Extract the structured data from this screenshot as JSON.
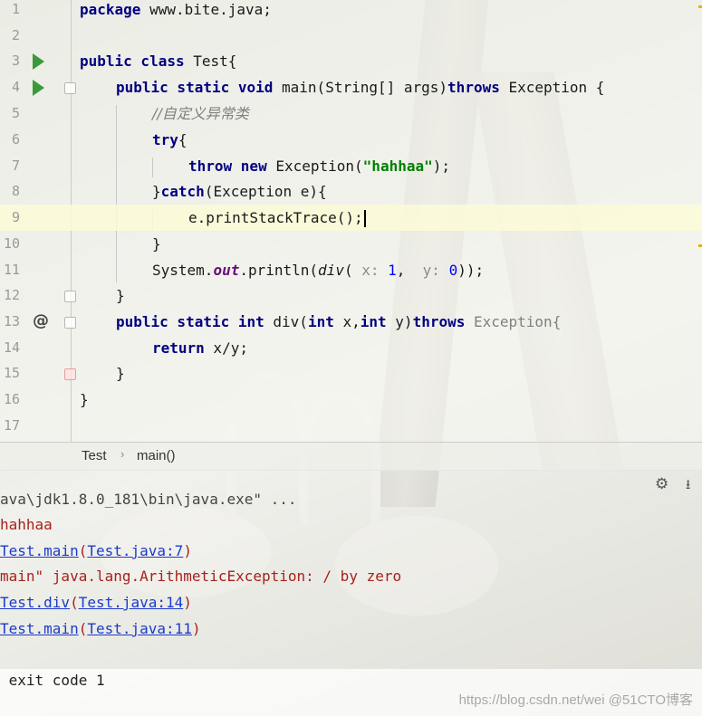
{
  "editor": {
    "lines": [
      {
        "n": "1"
      },
      {
        "n": "2"
      },
      {
        "n": "3"
      },
      {
        "n": "4"
      },
      {
        "n": "5"
      },
      {
        "n": "6"
      },
      {
        "n": "7"
      },
      {
        "n": "8"
      },
      {
        "n": "9"
      },
      {
        "n": "10"
      },
      {
        "n": "11"
      },
      {
        "n": "12"
      },
      {
        "n": "13"
      },
      {
        "n": "14"
      },
      {
        "n": "15"
      },
      {
        "n": "16"
      },
      {
        "n": "17"
      }
    ],
    "code": {
      "l1_kw": "package",
      "l1_rest": " www.bite.java;",
      "l3_kw": "public class",
      "l3_rest": " Test{",
      "l4_kw": "public static void",
      "l4_mid": " main(String[] args)",
      "l4_kw2": "throws",
      "l4_rest": " Exception {",
      "l5_comment": "//自定义异常类",
      "l6_kw": "try",
      "l6_rest": "{",
      "l7_kw": "throw new",
      "l7_mid": " Exception(",
      "l7_str": "\"hahhaa\"",
      "l7_rest": ");",
      "l8_pre": "}",
      "l8_kw": "catch",
      "l8_rest": "(Exception e){",
      "l9_code": "e.printStackTrace();",
      "l10_code": "}",
      "l11_pre": "System.",
      "l11_field": "out",
      "l11_mid": ".println(",
      "l11_call": "div",
      "l11_p1": "( ",
      "l11_hint1": "x:",
      "l11_sp1": " ",
      "l11_num1": "1",
      "l11_comma": ",  ",
      "l11_hint2": "y:",
      "l11_sp2": " ",
      "l11_num2": "0",
      "l11_rest": "));",
      "l12_code": "}",
      "l13_kw": "public static int",
      "l13_mid": " div(",
      "l13_kw2": "int",
      "l13_mid2": " x,",
      "l13_kw3": "int",
      "l13_mid3": " y)",
      "l13_kw4": "throws",
      "l13_rest": " Exception{",
      "l14_kw": "return",
      "l14_rest": " x/y;",
      "l15_code": "}",
      "l16_code": "}"
    }
  },
  "breadcrumb": {
    "class_name": "Test",
    "separator": "›",
    "method": "main()"
  },
  "console": {
    "line1": "ava\\jdk1.8.0_181\\bin\\java.exe\" ...",
    "line2": "hahhaa",
    "line3_a": "Test.main",
    "line3_b": "(",
    "line3_c": "Test.java:7",
    "line3_d": ")",
    "line4": "main\" java.lang.ArithmeticException: / by zero",
    "line5_a": "Test.div",
    "line5_b": "(",
    "line5_c": "Test.java:14",
    "line5_d": ")",
    "line6_a": "Test.main",
    "line6_b": "(",
    "line6_c": "Test.java:11",
    "line6_d": ")",
    "exit": " exit code 1"
  },
  "icons": {
    "run": "run-icon",
    "override": "@",
    "gear": "⚙",
    "pin": "⭳"
  },
  "watermark": "https://blog.csdn.net/wei @51CTO博客",
  "colors": {
    "keyword": "#000080",
    "string": "#008000",
    "error": "#a8211b",
    "link": "#1b3bcb",
    "run": "#3a9a3a"
  }
}
